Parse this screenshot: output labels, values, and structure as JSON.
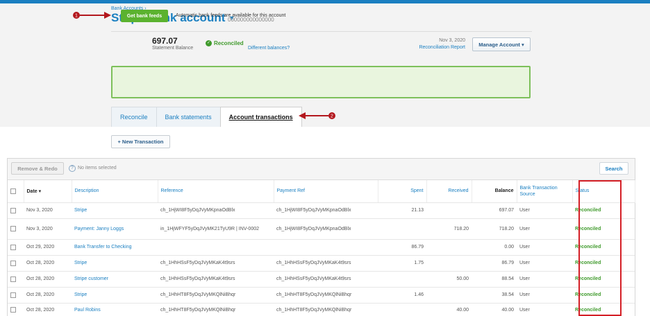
{
  "header": {
    "breadcrumb": "Bank Accounts ›",
    "account_title": "Stripe Bank account",
    "account_number": "000000000000000"
  },
  "callouts": {
    "marker_1": "1",
    "marker_2": "2"
  },
  "summary": {
    "balance": "697.07",
    "balance_label": "Statement Balance",
    "status": "Reconciled",
    "different_balances_link": "Different balances?",
    "reconciled_date": "Nov 3, 2020",
    "reconciliation_report_link": "Reconciliation Report",
    "manage_account_label": "Manage Account ▾"
  },
  "bank_feeds": {
    "button_label": "Get bank feeds",
    "message": "Automatic bank feeds are available for this account"
  },
  "tabs": [
    {
      "label": "Reconcile",
      "active": false
    },
    {
      "label": "Bank statements",
      "active": false
    },
    {
      "label": "Account transactions",
      "active": true
    }
  ],
  "new_transaction_label": "+ New Transaction",
  "toolbar": {
    "remove_redo_label": "Remove & Redo",
    "help_glyph": "?",
    "no_items_label": "No items selected",
    "search_label": "Search"
  },
  "table": {
    "columns": {
      "date": "Date ▾",
      "description": "Description",
      "reference": "Reference",
      "payment_ref": "Payment Ref",
      "spent": "Spent",
      "received": "Received",
      "balance": "Balance",
      "source": "Bank Transaction Source",
      "status": "Status"
    },
    "rows": [
      {
        "date": "Nov 3, 2020",
        "description": "Stripe",
        "reference": "ch_1HjWI8F5yDqJVyMKpnaOdBlx",
        "payment_ref": "ch_1HjWI8F5yDqJVyMKpnaOdBlx",
        "spent": "21.13",
        "received": "",
        "balance": "697.07",
        "source": "User",
        "status": "Reconciled"
      },
      {
        "date": "Nov 3, 2020",
        "description": "Payment: Janny Loggs",
        "reference": "in_1HjWFYF5yDqJVyMK21TyU9R | INV-0002",
        "payment_ref": "ch_1HjWI8F5yDqJVyMKpnaOdBlx",
        "spent": "",
        "received": "718.20",
        "balance": "718.20",
        "source": "User",
        "status": "Reconciled"
      },
      {
        "date": "Oct 29, 2020",
        "description": "Bank Transfer to Checking",
        "reference": "",
        "payment_ref": "",
        "spent": "86.79",
        "received": "",
        "balance": "0.00",
        "source": "User",
        "status": "Reconciled"
      },
      {
        "date": "Oct 28, 2020",
        "description": "Stripe",
        "reference": "ch_1HhHSsF5yDqJVyMKaK4t9srs",
        "payment_ref": "ch_1HhHSsF5yDqJVyMKaK4t9srs",
        "spent": "1.75",
        "received": "",
        "balance": "86.79",
        "source": "User",
        "status": "Reconciled"
      },
      {
        "date": "Oct 28, 2020",
        "description": "Stripe customer",
        "reference": "ch_1HhHSsF5yDqJVyMKaK4t9srs",
        "payment_ref": "ch_1HhHSsF5yDqJVyMKaK4t9srs",
        "spent": "",
        "received": "50.00",
        "balance": "88.54",
        "source": "User",
        "status": "Reconciled"
      },
      {
        "date": "Oct 28, 2020",
        "description": "Stripe",
        "reference": "ch_1HhHT8F5yDqJVyMKQlNiBhqr",
        "payment_ref": "ch_1HhHT8F5yDqJVyMKQlNiBhqr",
        "spent": "1.46",
        "received": "",
        "balance": "38.54",
        "source": "User",
        "status": "Reconciled"
      },
      {
        "date": "Oct 28, 2020",
        "description": "Paul Robins",
        "reference": "ch_1HhHT8F5yDqJVyMKQlNiBhqr",
        "payment_ref": "ch_1HhHT8F5yDqJVyMKQlNiBhqr",
        "spent": "",
        "received": "40.00",
        "balance": "40.00",
        "source": "User",
        "status": "Reconciled"
      }
    ]
  },
  "colors": {
    "brand_blue": "#1a7fc1",
    "reconciled_green": "#3f9a2b",
    "feeds_green": "#5bb22f",
    "annotation_red": "#b3171d"
  }
}
